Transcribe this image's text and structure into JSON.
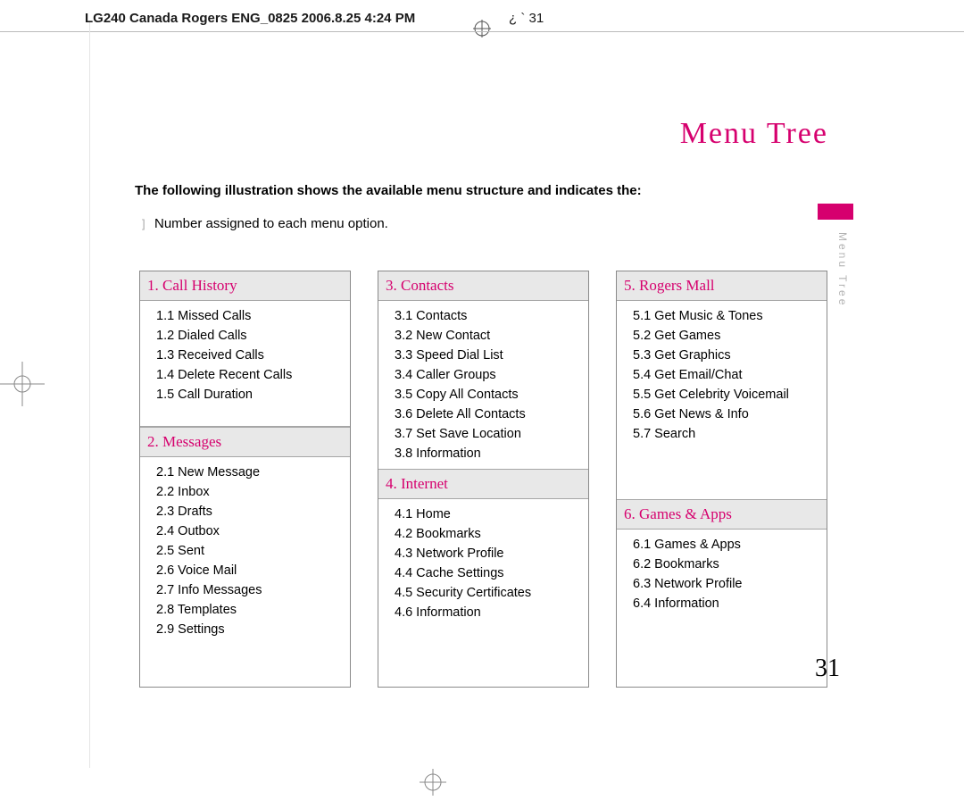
{
  "header": {
    "filename": "LG240 Canada Rogers ENG_0825  2006.8.25 4:24 PM",
    "page_ref": "¿   ` 31"
  },
  "page": {
    "title": "Menu Tree",
    "side_label": "Menu Tree",
    "intro_bold": "The following illustration shows the available menu structure and indicates the:",
    "intro_line": "Number assigned to each menu option.",
    "page_number": "31"
  },
  "columns": [
    {
      "sections": [
        {
          "title": "1. Call History",
          "items": [
            "1.1 Missed Calls",
            "1.2 Dialed Calls",
            "1.3 Received Calls",
            "1.4 Delete Recent Calls",
            "1.5 Call Duration"
          ],
          "spacer_after": true
        },
        {
          "title": "2. Messages",
          "items": [
            "2.1 New Message",
            "2.2 Inbox",
            "2.3 Drafts",
            "2.4 Outbox",
            "2.5 Sent",
            "2.6 Voice Mail",
            "2.7 Info Messages",
            "2.8 Templates",
            "2.9 Settings"
          ]
        }
      ]
    },
    {
      "sections": [
        {
          "title": "3. Contacts",
          "items": [
            "3.1 Contacts",
            "3.2 New Contact",
            "3.3 Speed Dial List",
            "3.4 Caller Groups",
            "3.5 Copy All Contacts",
            "3.6 Delete All Contacts",
            "3.7 Set Save Location",
            "3.8 Information"
          ]
        },
        {
          "title": "4. Internet",
          "items": [
            "4.1 Home",
            "4.2 Bookmarks",
            "4.3 Network Profile",
            "4.4 Cache Settings",
            "4.5 Security Certificates",
            "4.6 Information"
          ]
        }
      ]
    },
    {
      "sections": [
        {
          "title": "5. Rogers Mall",
          "items": [
            "5.1 Get Music & Tones",
            "5.2 Get Games",
            "5.3 Get Graphics",
            "5.4 Get Email/Chat",
            "5.5 Get Celebrity Voicemail",
            "5.6 Get News & Info",
            "5.7 Search"
          ],
          "pad_after": 56
        },
        {
          "title": "6. Games & Apps",
          "items": [
            "6.1 Games & Apps",
            "6.2 Bookmarks",
            "6.3 Network Profile",
            "6.4 Information"
          ]
        }
      ]
    }
  ]
}
